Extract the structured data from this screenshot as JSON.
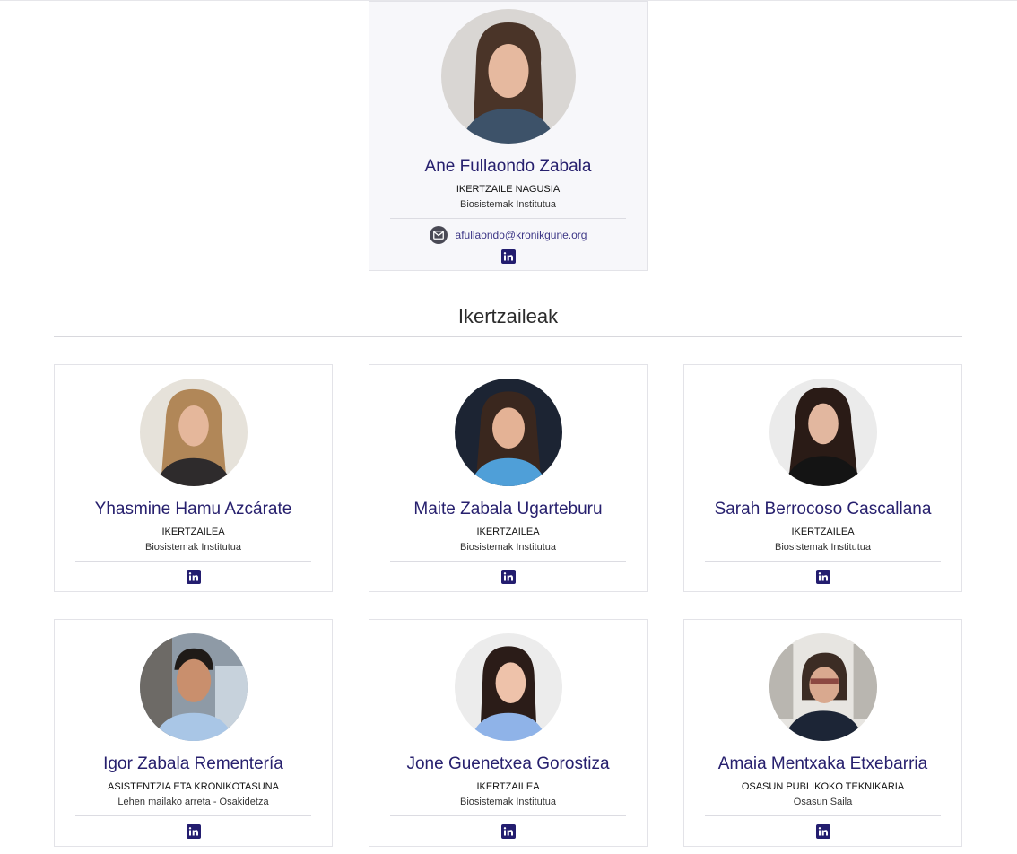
{
  "featured": {
    "name": "Ane Fullaondo Zabala",
    "role": "IKERTZAILE NAGUSIA",
    "org": "Biosistemak Institutua",
    "email": "afullaondo@kronikgune.org",
    "email_icon": "envelope-icon",
    "social_icon": "linkedin-icon"
  },
  "section": {
    "title": "Ikertzaileak"
  },
  "researchers": [
    {
      "name": "Yhasmine Hamu Azcárate",
      "role": "IKERTZAILEA",
      "org": "Biosistemak Institutua"
    },
    {
      "name": "Maite Zabala Ugarteburu",
      "role": "IKERTZAILEA",
      "org": "Biosistemak Institutua"
    },
    {
      "name": "Sarah Berrocoso Cascallana",
      "role": "IKERTZAILEA",
      "org": "Biosistemak Institutua"
    },
    {
      "name": "Igor Zabala Rementería",
      "role": "ASISTENTZIA ETA KRONIKOTASUNA",
      "org": "Lehen mailako arreta - Osakidetza"
    },
    {
      "name": "Jone Guenetxea Gorostiza",
      "role": "IKERTZAILEA",
      "org": "Biosistemak Institutua"
    },
    {
      "name": "Amaia Mentxaka Etxebarria",
      "role": "OSASUN PUBLIKOKO TEKNIKARIA",
      "org": "Osasun Saila"
    }
  ],
  "colors": {
    "name": "#27206e",
    "linkedin": "#231d6f",
    "border": "#e3e3e8"
  }
}
